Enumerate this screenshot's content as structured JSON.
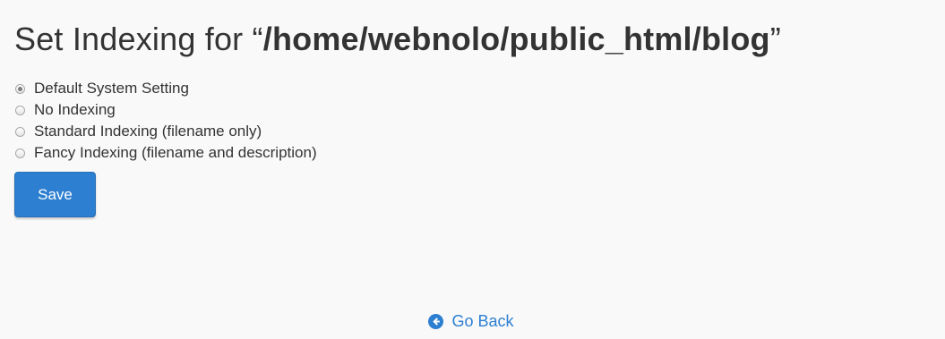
{
  "header": {
    "title_prefix": "Set Indexing for “",
    "path": "/home/webnolo/public_html/blog",
    "title_suffix": "”"
  },
  "options": [
    {
      "label": "Default System Setting",
      "checked": true
    },
    {
      "label": "No Indexing",
      "checked": false
    },
    {
      "label": "Standard Indexing (filename only)",
      "checked": false
    },
    {
      "label": "Fancy Indexing (filename and description)",
      "checked": false
    }
  ],
  "actions": {
    "save_label": "Save",
    "go_back_label": "Go Back"
  },
  "colors": {
    "accent": "#2d7fd1",
    "background": "#f9f9f9",
    "text": "#333333"
  },
  "icons": {
    "go_back": "arrow-left-circle-icon"
  }
}
